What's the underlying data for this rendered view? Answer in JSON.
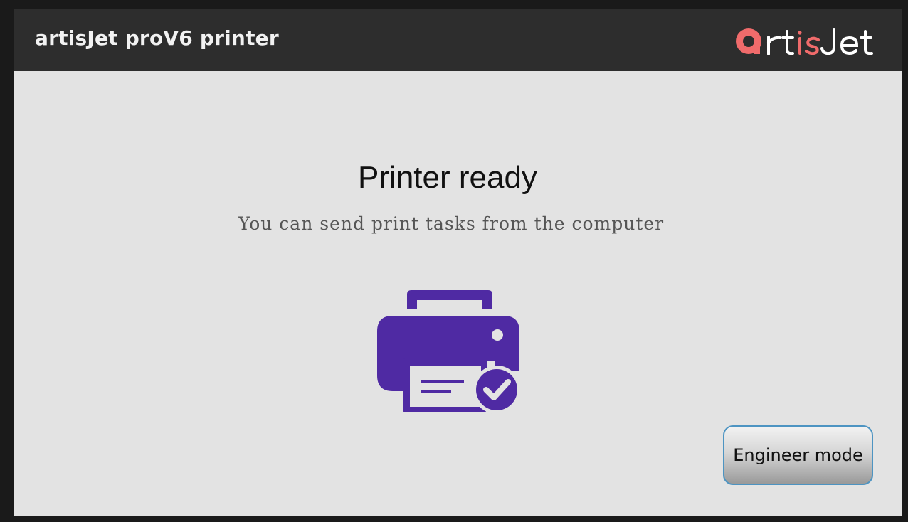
{
  "header": {
    "title": "artisJet proV6 printer",
    "logo_text": "artisJet",
    "logo_accent_color": "#f06b6b",
    "logo_text_color": "#ffffff"
  },
  "status": {
    "title": "Printer ready",
    "subtitle": "You can send print tasks from the computer",
    "icon": "printer-check-icon",
    "icon_color": "#4f2aa3"
  },
  "actions": {
    "engineer_mode_label": "Engineer mode",
    "button_border_color": "#4d94c2"
  },
  "colors": {
    "header_background": "#2d2d2d",
    "panel_background": "#e3e3e3",
    "frame": "#1a1a1a"
  }
}
